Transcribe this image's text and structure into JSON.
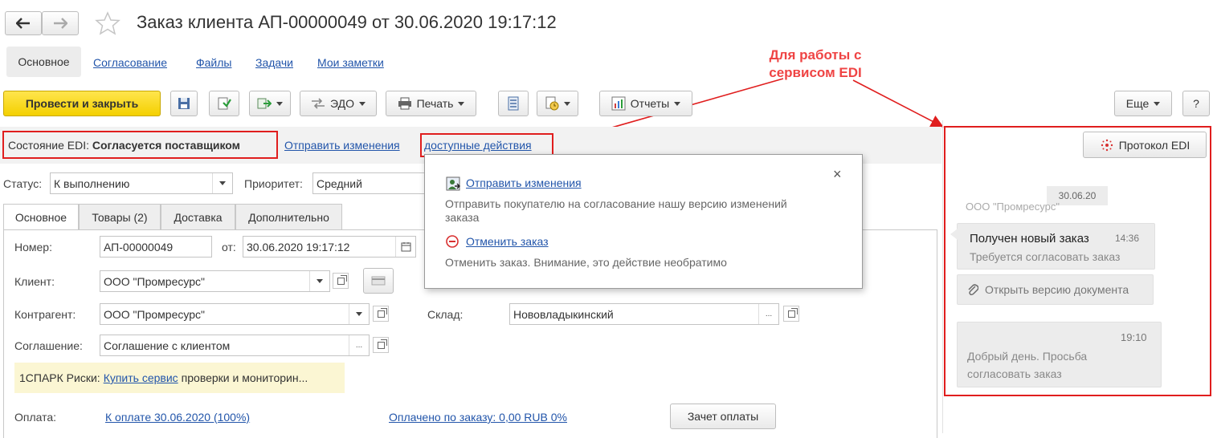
{
  "window": {
    "title": "Заказ клиента АП-00000049 от 30.06.2020 19:17:12"
  },
  "nav": {
    "back": "back",
    "forward": "forward"
  },
  "sections": {
    "main": "Основное",
    "approval": "Согласование",
    "files": "Файлы",
    "tasks": "Задачи",
    "notes": "Мои заметки"
  },
  "annotation": {
    "text_line1": "Для работы с",
    "text_line2": "сервисом EDI",
    "color": "#ef4444"
  },
  "toolbar": {
    "post_close": "Провести и закрыть",
    "edo": "ЭДО",
    "print": "Печать",
    "reports": "Отчеты",
    "more": "Еще",
    "help": "?"
  },
  "edi_bar": {
    "state_label": "Состояние EDI:",
    "state_value": "Согласуется поставщиком",
    "send_changes": "Отправить изменения",
    "available_actions": "доступные действия"
  },
  "popup": {
    "action1_title": "Отправить изменения",
    "action1_desc_line1": "Отправить покупателю на согласование нашу версию изменений",
    "action1_desc_line2": "заказа",
    "action2_title": "Отменить заказ",
    "action2_desc": "Отменить заказ. Внимание, это действие необратимо",
    "close": "×"
  },
  "status_row": {
    "status_label": "Статус:",
    "status_value": "К выполнению",
    "priority_label": "Приоритет:",
    "priority_value": "Средний"
  },
  "tabs": [
    "Основное",
    "Товары (2)",
    "Доставка",
    "Дополнительно"
  ],
  "form": {
    "number_label": "Номер:",
    "number_value": "АП-00000049",
    "from_label": "от:",
    "date_value": "30.06.2020 19:17:12",
    "client_label": "Клиент:",
    "client_value": "ООО \"Промресурс\"",
    "contractor_label": "Контрагент:",
    "contractor_value": "ООО \"Промресурс\"",
    "warehouse_label": "Склад:",
    "warehouse_value": "Нововладыкинский",
    "agreement_label": "Соглашение:",
    "agreement_value": "Соглашение с клиентом",
    "spark_prefix": "1СПАРК Риски:",
    "spark_link": "Купить сервис",
    "spark_suffix": "проверки и мониторин...",
    "payment_label": "Оплата:",
    "payment_link": "К оплате 30.06.2020 (100%)",
    "paid_link": "Оплачено по заказу: 0,00 RUB 0%",
    "offset_button": "Зачет оплаты",
    "dots": "..."
  },
  "edi_panel": {
    "protocol_button": "Протокол EDI",
    "date": "30.06.20",
    "sender": "ООО \"Промресурс\"",
    "msg1_title": "Получен новый заказ",
    "msg1_time": "14:36",
    "msg1_text": "Требуется согласовать заказ",
    "open_version": "Открыть версию документа",
    "msg2_time": "19:10",
    "msg2_line1": "Добрый день. Просьба",
    "msg2_line2": "согласовать заказ"
  }
}
